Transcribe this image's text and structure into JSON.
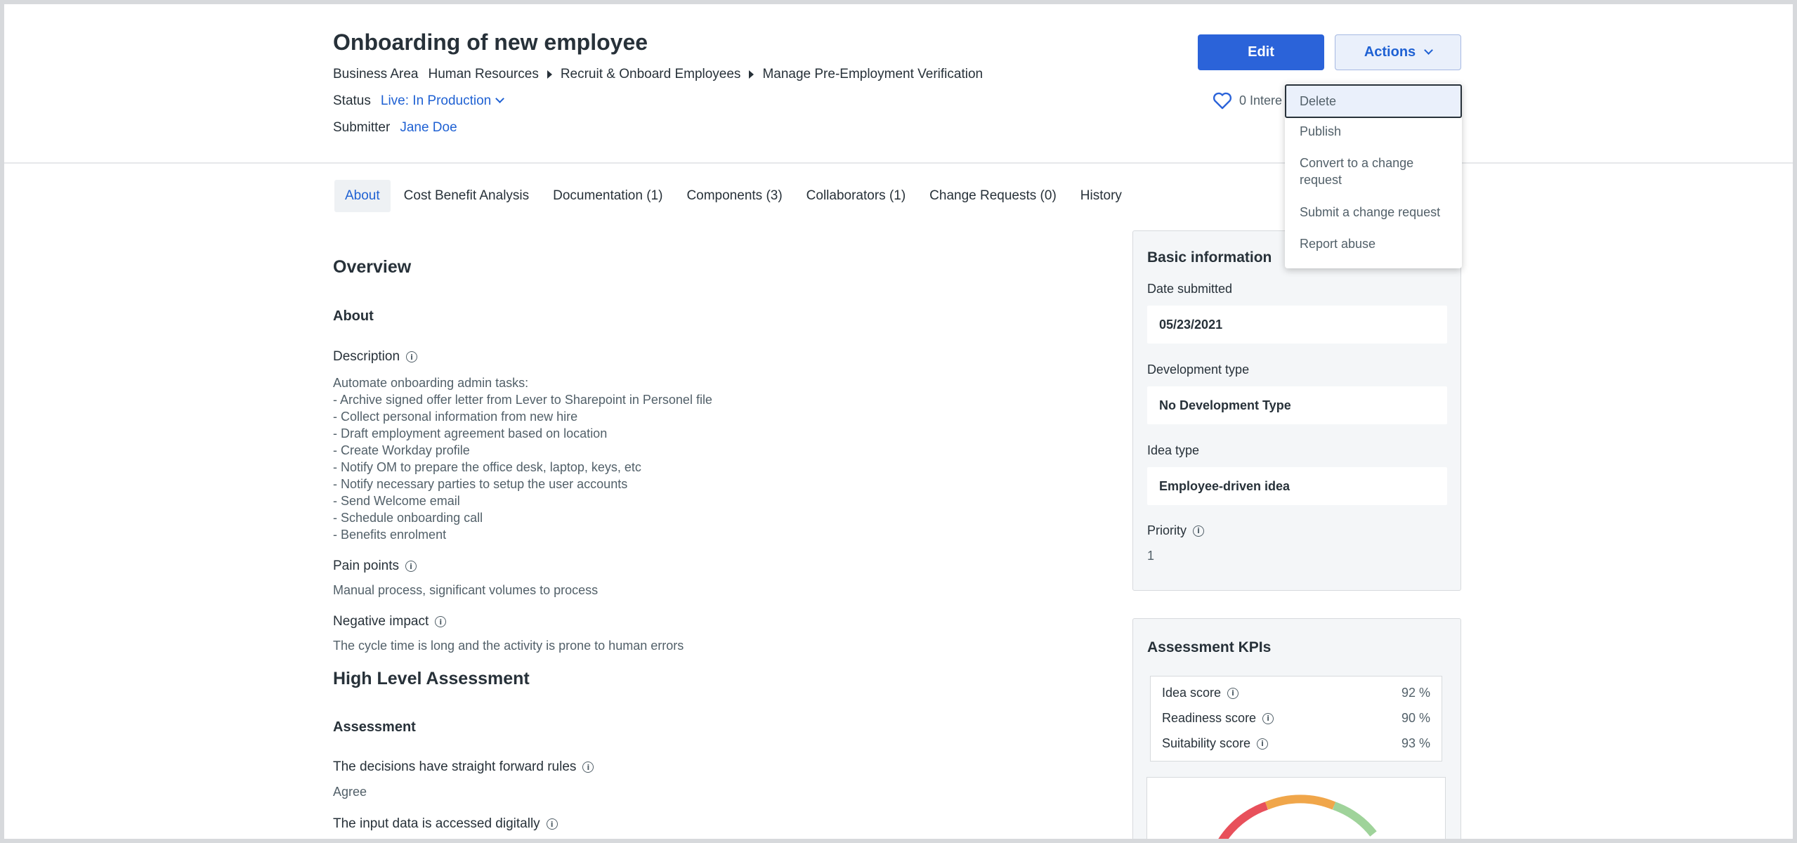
{
  "header": {
    "title": "Onboarding of new employee",
    "business_area_label": "Business Area",
    "breadcrumb": [
      "Human Resources",
      "Recruit & Onboard Employees",
      "Manage Pre-Employment Verification"
    ],
    "status_label": "Status",
    "status_value": "Live: In Production",
    "submitter_label": "Submitter",
    "submitter_value": "Jane Doe",
    "edit_label": "Edit",
    "actions_label": "Actions",
    "interest_text": "0 Intere"
  },
  "actions_menu": {
    "items": [
      "Delete",
      "Publish",
      "Convert to a change request",
      "Submit a change request",
      "Report abuse"
    ],
    "selected": "Delete"
  },
  "tabs": [
    {
      "label": "About",
      "active": true
    },
    {
      "label": "Cost Benefit Analysis"
    },
    {
      "label": "Documentation (1)"
    },
    {
      "label": "Components (3)"
    },
    {
      "label": "Collaborators (1)"
    },
    {
      "label": "Change Requests (0)"
    },
    {
      "label": "History"
    }
  ],
  "main": {
    "overview_title": "Overview",
    "about_title": "About",
    "description_label": "Description",
    "description_lines": [
      "Automate onboarding admin tasks:",
      "- Archive signed offer letter from Lever to Sharepoint in Personel file",
      "- Collect personal information from new hire",
      "- Draft employment agreement based on location",
      "- Create Workday profile",
      "- Notify OM to prepare the office desk, laptop, keys, etc",
      "- Notify necessary parties to setup the user accounts",
      "- Send Welcome email",
      "- Schedule onboarding call",
      "- Benefits enrolment"
    ],
    "pain_points_label": "Pain points",
    "pain_points_value": "Manual process, significant volumes to process",
    "negative_impact_label": "Negative impact",
    "negative_impact_value": "The cycle time is long and the activity is prone to human errors",
    "hla_title": "High Level Assessment",
    "assessment_title": "Assessment",
    "q1_label": "The decisions have straight forward rules",
    "q1_value": "Agree",
    "q2_label": "The input data is accessed digitally"
  },
  "basic_info": {
    "title": "Basic information",
    "date_submitted_label": "Date submitted",
    "date_submitted_value": "05/23/2021",
    "development_type_label": "Development type",
    "development_type_value": "No Development Type",
    "idea_type_label": "Idea type",
    "idea_type_value": "Employee-driven idea",
    "priority_label": "Priority",
    "priority_value": "1"
  },
  "kpis": {
    "title": "Assessment KPIs",
    "rows": [
      {
        "name": "Idea score",
        "value": "92 %"
      },
      {
        "name": "Readiness score",
        "value": "90 %"
      },
      {
        "name": "Suitability score",
        "value": "93 %"
      }
    ]
  },
  "colors": {
    "primary": "#2b63d9",
    "link": "#1f61d3",
    "text": "#273139",
    "muted": "#526069",
    "panel_bg": "#f4f6f8",
    "gauge_red": "#e8505b",
    "gauge_orange": "#f0a64a",
    "gauge_green": "#9fd39a"
  },
  "icons": {
    "heart": "heart-icon",
    "info": "info-icon",
    "breadcrumb_separator": "caret-right-icon",
    "dropdown": "chevron-down-icon"
  }
}
